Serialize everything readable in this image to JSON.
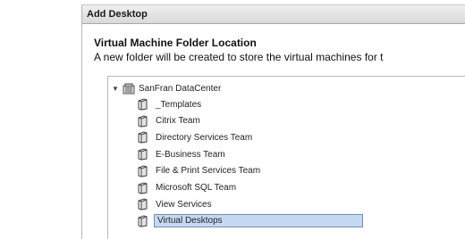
{
  "dialog": {
    "title": "Add Desktop"
  },
  "page": {
    "heading": "Virtual Machine Folder Location",
    "description": "A new folder will be created to store the virtual machines for t"
  },
  "tree": {
    "root": {
      "label": "SanFran DataCenter",
      "expanded": true,
      "icon": "datacenter-icon"
    },
    "items": [
      {
        "label": "_Templates",
        "icon": "folder-icon",
        "selected": false
      },
      {
        "label": "Citrix Team",
        "icon": "folder-icon",
        "selected": false
      },
      {
        "label": "Directory Services Team",
        "icon": "folder-icon",
        "selected": false
      },
      {
        "label": "E-Business Team",
        "icon": "folder-icon",
        "selected": false
      },
      {
        "label": "File & Print Services Team",
        "icon": "folder-icon",
        "selected": false
      },
      {
        "label": "Microsoft SQL Team",
        "icon": "folder-icon",
        "selected": false
      },
      {
        "label": "View Services",
        "icon": "folder-icon",
        "selected": false
      },
      {
        "label": "Virtual Desktops",
        "icon": "folder-icon",
        "selected": true
      }
    ]
  },
  "colors": {
    "selection_fill": "#c5daf2",
    "selection_border": "#6f8db8"
  }
}
